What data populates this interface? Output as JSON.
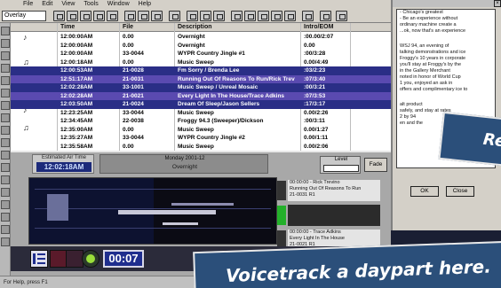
{
  "menu": [
    "File",
    "Edit",
    "View",
    "Tools",
    "Window",
    "Help"
  ],
  "toolbar": {
    "combo_value": "Overlay"
  },
  "grid": {
    "columns": [
      "Time",
      "File",
      "Description",
      "Intro/EOM"
    ],
    "rows": [
      {
        "time": "12:00:00AM",
        "file": "0.00",
        "desc": "Overnight",
        "intro": ":00.00/2:07"
      },
      {
        "time": "12:00:00AM",
        "file": "0.00",
        "desc": "Overnight",
        "intro": "0.00"
      },
      {
        "time": "12:00:00AM",
        "file": "33-0044",
        "desc": "WYPR Country Jingle #1",
        "intro": ":00/3:28"
      },
      {
        "time": "12:00:18AM",
        "file": "0.00",
        "desc": "Music Sweep",
        "intro": "0.00/4:49"
      },
      {
        "time": "12:00:53AM",
        "file": "21-0028",
        "desc": "Fm Sorry / Brenda Lee",
        "intro": ":03/2:23"
      },
      {
        "time": "12:51:17AM",
        "file": "21-0031",
        "desc": "Running Out Of Reasons To Run/Rick Trev",
        "intro": ":07/3:40"
      },
      {
        "time": "12:02:28AM",
        "file": "33-1001",
        "desc": "Music Sweep / Unreal Mosaic",
        "intro": ":00/3:21"
      },
      {
        "time": "12:02:28AM",
        "file": "21-0021",
        "desc": "Every Light In The House/Trace Adkins",
        "intro": ":07/3:53"
      },
      {
        "time": "12:03:50AM",
        "file": "21-0024",
        "desc": "Dream Of Sleep/Jason Sellers",
        "intro": ":17/3:17"
      },
      {
        "time": "12:23:25AM",
        "file": "33-0044",
        "desc": "Music Sweep",
        "intro": "0.00/2:26"
      },
      {
        "time": "12:34:45AM",
        "file": "22-0038",
        "desc": "Froggy 94.3 (Sweeper)/Dickson",
        "intro": ":00/3:11"
      },
      {
        "time": "12:35:00AM",
        "file": "0.00",
        "desc": "Music Sweep",
        "intro": "0.00/1:27"
      },
      {
        "time": "12:35:27AM",
        "file": "33-0044",
        "desc": "WYPR Country Jingle #2",
        "intro": "0.00/1:11"
      },
      {
        "time": "12:35:58AM",
        "file": "0.00",
        "desc": "Music Sweep",
        "intro": "0.00/2:06"
      }
    ]
  },
  "count_panel": {
    "label": "Estimated Air Time",
    "value": "12:02:18AM"
  },
  "status_panel": {
    "line1": "Monday 2001-12",
    "line2": "Overnight"
  },
  "level_label": "Level",
  "fade_label": "Fade",
  "carts": [
    {
      "line1": "00:00:00 - Rick Trevino",
      "line2": "Running Out Of Reasons To Run",
      "line3": "21-0031 R1"
    },
    {
      "line1": "",
      "line2": "",
      "line3": ""
    },
    {
      "line1": "00:00:00 - Trace Adkins",
      "line2": "Every Light In The House",
      "line3": "21-0021 R1"
    }
  ],
  "transport": {
    "time": "00:07"
  },
  "statusbar": "For Help, press F1",
  "notes": {
    "lines": [
      "- Chicago's greatest",
      "- Be an experience without",
      "  ordinary machine create a",
      "  ...ok, now that's an experience",
      "",
      "  WSJ 94, an evening of",
      "  talking demonstrations and ice",
      "  Froggy's 10 years in corporate",
      "  you'll stay at Froggy's by the",
      "  in the Gallery Merchant",
      "  noted in honor of World Cup",
      "  1 you, enjoyed an ask in",
      "  offers and complimentary ice to",
      "",
      "  alt product",
      "  safely, and stay at rates",
      "  2 by 94",
      "  en and the"
    ],
    "ok_label": "OK",
    "close_label": "Close"
  },
  "callouts": {
    "top": "Re",
    "bottom": "Voicetrack a daypart here."
  }
}
